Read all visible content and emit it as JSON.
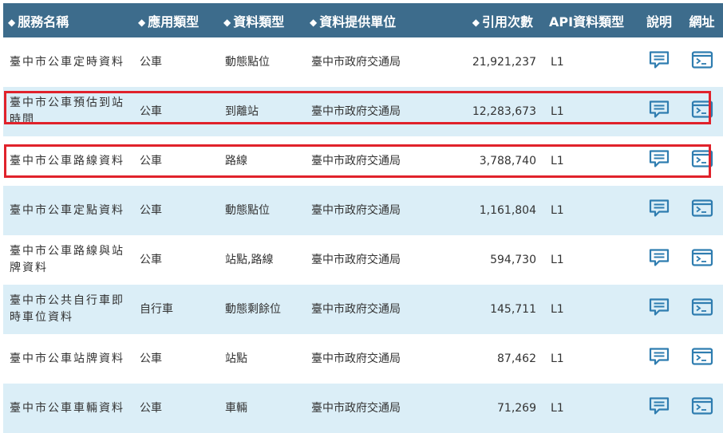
{
  "header": {
    "name": "服務名稱",
    "app_type": "應用類型",
    "data_type": "資料類型",
    "provider": "資料提供單位",
    "citations": "引用次數",
    "api_type": "API資料類型",
    "description": "說明",
    "url": "網址"
  },
  "rows": [
    {
      "name": "臺中市公車定時資料",
      "app_type": "公車",
      "data_type": "動態點位",
      "provider": "臺中市政府交通局",
      "citations": "21,921,237",
      "api_type": "L1"
    },
    {
      "name": "臺中市公車預估到站時間",
      "app_type": "公車",
      "data_type": "到離站",
      "provider": "臺中市政府交通局",
      "citations": "12,283,673",
      "api_type": "L1"
    },
    {
      "name": "臺中市公車路線資料",
      "app_type": "公車",
      "data_type": "路線",
      "provider": "臺中市政府交通局",
      "citations": "3,788,740",
      "api_type": "L1"
    },
    {
      "name": "臺中市公車定點資料",
      "app_type": "公車",
      "data_type": "動態點位",
      "provider": "臺中市政府交通局",
      "citations": "1,161,804",
      "api_type": "L1"
    },
    {
      "name": "臺中市公車路線與站牌資料",
      "app_type": "公車",
      "data_type": "站點,路線",
      "provider": "臺中市政府交通局",
      "citations": "594,730",
      "api_type": "L1"
    },
    {
      "name": "臺中市公共自行車即時車位資料",
      "app_type": "自行車",
      "data_type": "動態剩餘位",
      "provider": "臺中市政府交通局",
      "citations": "145,711",
      "api_type": "L1"
    },
    {
      "name": "臺中市公車站牌資料",
      "app_type": "公車",
      "data_type": "站點",
      "provider": "臺中市政府交通局",
      "citations": "87,462",
      "api_type": "L1"
    },
    {
      "name": "臺中市公車車輛資料",
      "app_type": "公車",
      "data_type": "車輛",
      "provider": "臺中市政府交通局",
      "citations": "71,269",
      "api_type": "L1"
    }
  ],
  "colors": {
    "header_bg": "#3d6c8c",
    "row_alt": "#dbeef7",
    "icon": "#2f7db0",
    "highlight": "#e0222b"
  },
  "icons": {
    "sort": "sort-icon",
    "description": "speech-bubble-icon",
    "url": "terminal-icon"
  }
}
